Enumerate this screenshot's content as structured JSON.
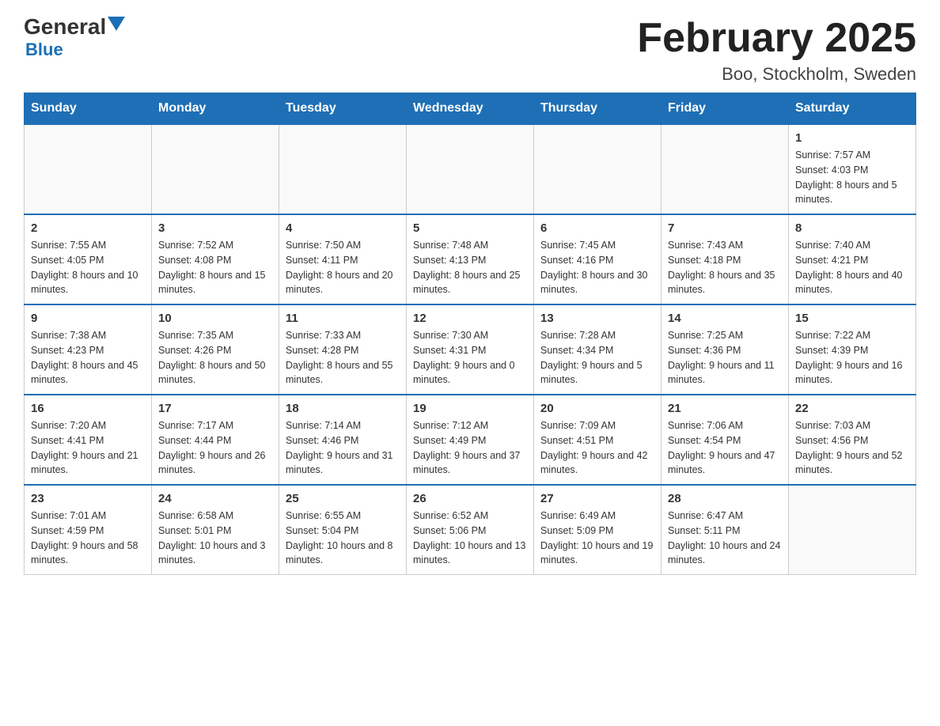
{
  "header": {
    "logo_general": "General",
    "logo_blue": "Blue",
    "month_title": "February 2025",
    "location": "Boo, Stockholm, Sweden"
  },
  "days_of_week": [
    "Sunday",
    "Monday",
    "Tuesday",
    "Wednesday",
    "Thursday",
    "Friday",
    "Saturday"
  ],
  "weeks": [
    [
      {
        "day": "",
        "info": ""
      },
      {
        "day": "",
        "info": ""
      },
      {
        "day": "",
        "info": ""
      },
      {
        "day": "",
        "info": ""
      },
      {
        "day": "",
        "info": ""
      },
      {
        "day": "",
        "info": ""
      },
      {
        "day": "1",
        "info": "Sunrise: 7:57 AM\nSunset: 4:03 PM\nDaylight: 8 hours and 5 minutes."
      }
    ],
    [
      {
        "day": "2",
        "info": "Sunrise: 7:55 AM\nSunset: 4:05 PM\nDaylight: 8 hours and 10 minutes."
      },
      {
        "day": "3",
        "info": "Sunrise: 7:52 AM\nSunset: 4:08 PM\nDaylight: 8 hours and 15 minutes."
      },
      {
        "day": "4",
        "info": "Sunrise: 7:50 AM\nSunset: 4:11 PM\nDaylight: 8 hours and 20 minutes."
      },
      {
        "day": "5",
        "info": "Sunrise: 7:48 AM\nSunset: 4:13 PM\nDaylight: 8 hours and 25 minutes."
      },
      {
        "day": "6",
        "info": "Sunrise: 7:45 AM\nSunset: 4:16 PM\nDaylight: 8 hours and 30 minutes."
      },
      {
        "day": "7",
        "info": "Sunrise: 7:43 AM\nSunset: 4:18 PM\nDaylight: 8 hours and 35 minutes."
      },
      {
        "day": "8",
        "info": "Sunrise: 7:40 AM\nSunset: 4:21 PM\nDaylight: 8 hours and 40 minutes."
      }
    ],
    [
      {
        "day": "9",
        "info": "Sunrise: 7:38 AM\nSunset: 4:23 PM\nDaylight: 8 hours and 45 minutes."
      },
      {
        "day": "10",
        "info": "Sunrise: 7:35 AM\nSunset: 4:26 PM\nDaylight: 8 hours and 50 minutes."
      },
      {
        "day": "11",
        "info": "Sunrise: 7:33 AM\nSunset: 4:28 PM\nDaylight: 8 hours and 55 minutes."
      },
      {
        "day": "12",
        "info": "Sunrise: 7:30 AM\nSunset: 4:31 PM\nDaylight: 9 hours and 0 minutes."
      },
      {
        "day": "13",
        "info": "Sunrise: 7:28 AM\nSunset: 4:34 PM\nDaylight: 9 hours and 5 minutes."
      },
      {
        "day": "14",
        "info": "Sunrise: 7:25 AM\nSunset: 4:36 PM\nDaylight: 9 hours and 11 minutes."
      },
      {
        "day": "15",
        "info": "Sunrise: 7:22 AM\nSunset: 4:39 PM\nDaylight: 9 hours and 16 minutes."
      }
    ],
    [
      {
        "day": "16",
        "info": "Sunrise: 7:20 AM\nSunset: 4:41 PM\nDaylight: 9 hours and 21 minutes."
      },
      {
        "day": "17",
        "info": "Sunrise: 7:17 AM\nSunset: 4:44 PM\nDaylight: 9 hours and 26 minutes."
      },
      {
        "day": "18",
        "info": "Sunrise: 7:14 AM\nSunset: 4:46 PM\nDaylight: 9 hours and 31 minutes."
      },
      {
        "day": "19",
        "info": "Sunrise: 7:12 AM\nSunset: 4:49 PM\nDaylight: 9 hours and 37 minutes."
      },
      {
        "day": "20",
        "info": "Sunrise: 7:09 AM\nSunset: 4:51 PM\nDaylight: 9 hours and 42 minutes."
      },
      {
        "day": "21",
        "info": "Sunrise: 7:06 AM\nSunset: 4:54 PM\nDaylight: 9 hours and 47 minutes."
      },
      {
        "day": "22",
        "info": "Sunrise: 7:03 AM\nSunset: 4:56 PM\nDaylight: 9 hours and 52 minutes."
      }
    ],
    [
      {
        "day": "23",
        "info": "Sunrise: 7:01 AM\nSunset: 4:59 PM\nDaylight: 9 hours and 58 minutes."
      },
      {
        "day": "24",
        "info": "Sunrise: 6:58 AM\nSunset: 5:01 PM\nDaylight: 10 hours and 3 minutes."
      },
      {
        "day": "25",
        "info": "Sunrise: 6:55 AM\nSunset: 5:04 PM\nDaylight: 10 hours and 8 minutes."
      },
      {
        "day": "26",
        "info": "Sunrise: 6:52 AM\nSunset: 5:06 PM\nDaylight: 10 hours and 13 minutes."
      },
      {
        "day": "27",
        "info": "Sunrise: 6:49 AM\nSunset: 5:09 PM\nDaylight: 10 hours and 19 minutes."
      },
      {
        "day": "28",
        "info": "Sunrise: 6:47 AM\nSunset: 5:11 PM\nDaylight: 10 hours and 24 minutes."
      },
      {
        "day": "",
        "info": ""
      }
    ]
  ]
}
